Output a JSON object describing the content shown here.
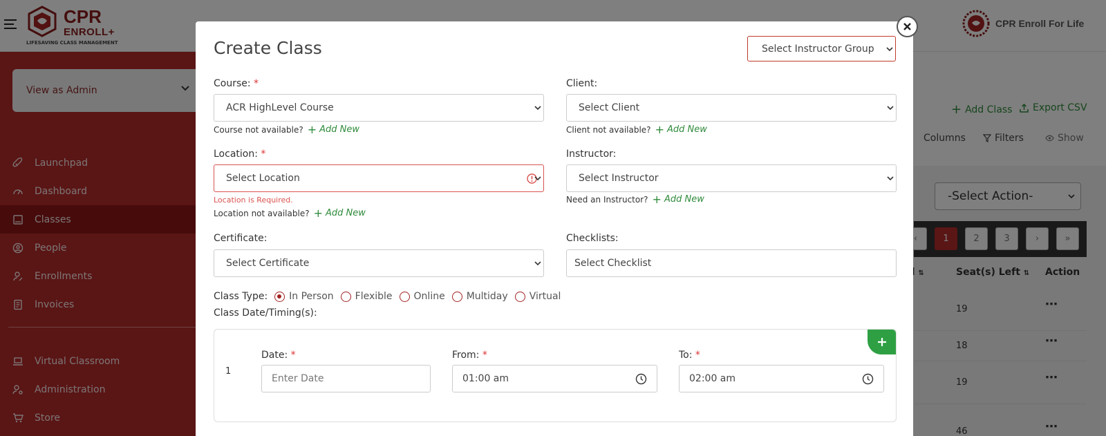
{
  "app": {
    "logo": {
      "line1": "CPR",
      "line2": "ENROLL+",
      "tagline": "LIFESAVING CLASS MANAGEMENT"
    },
    "brand_right": "CPR Enroll For Life",
    "colors": {
      "primary": "#b42a2a",
      "active": "#8e1717",
      "success": "#2ea043",
      "error": "#d9534f"
    }
  },
  "sidebar": {
    "view_as": "View as Admin",
    "items": [
      {
        "label": "Launchpad",
        "icon": "rocket-icon"
      },
      {
        "label": "Dashboard",
        "icon": "gauge-icon"
      },
      {
        "label": "Classes",
        "icon": "book-icon",
        "active": true
      },
      {
        "label": "People",
        "icon": "user-circle-icon"
      },
      {
        "label": "Enrollments",
        "icon": "user-edit-icon"
      },
      {
        "label": "Invoices",
        "icon": "receipt-icon"
      }
    ],
    "items_bottom": [
      {
        "label": "Virtual Classroom",
        "icon": "laptop-icon"
      },
      {
        "label": "Administration",
        "icon": "user-gear-icon"
      },
      {
        "label": "Store",
        "icon": "cart-icon"
      }
    ]
  },
  "background": {
    "add_class": "Add Class",
    "export_csv": "Export CSV",
    "columns": "Columns",
    "filters": "Filters",
    "show": "Show",
    "select_action": "-Select Action-",
    "pages": [
      "‹",
      "1",
      "2",
      "3",
      "›",
      "»"
    ],
    "current_page": "1",
    "headers": [
      "ed",
      "Seat(s) Left",
      "Action"
    ],
    "seats_left": [
      "19",
      "18",
      "19",
      "46"
    ]
  },
  "modal": {
    "title": "Create Class",
    "instructor_group_placeholder": "Select Instructor Group",
    "course": {
      "label": "Course:",
      "required": "*",
      "value": "ACR HighLevel Course",
      "hint": "Course not available?",
      "add": "Add New"
    },
    "client": {
      "label": "Client:",
      "value": "Select Client",
      "hint": "Client not available?",
      "add": "Add New"
    },
    "location": {
      "label": "Location:",
      "required": "*",
      "value": "Select Location",
      "error": "Location is Required.",
      "hint": "Location not available?",
      "add": "Add New"
    },
    "instructor": {
      "label": "Instructor:",
      "value": "Select Instructor",
      "hint": "Need an Instructor?",
      "add": "Add New"
    },
    "certificate": {
      "label": "Certificate:",
      "value": "Select Certificate"
    },
    "checklists": {
      "label": "Checklists:",
      "value": "Select Checklist"
    },
    "class_type": {
      "label": "Class Type:",
      "options": [
        "In Person",
        "Flexible",
        "Online",
        "Multiday",
        "Virtual"
      ],
      "selected": "In Person"
    },
    "timing": {
      "label": "Class Date/Timing(s):",
      "row_number": "1",
      "date_label": "Date:",
      "date_placeholder": "Enter Date",
      "from_label": "From:",
      "from_value": "01:00 am",
      "to_label": "To:",
      "to_value": "02:00 am",
      "required": "*"
    }
  }
}
